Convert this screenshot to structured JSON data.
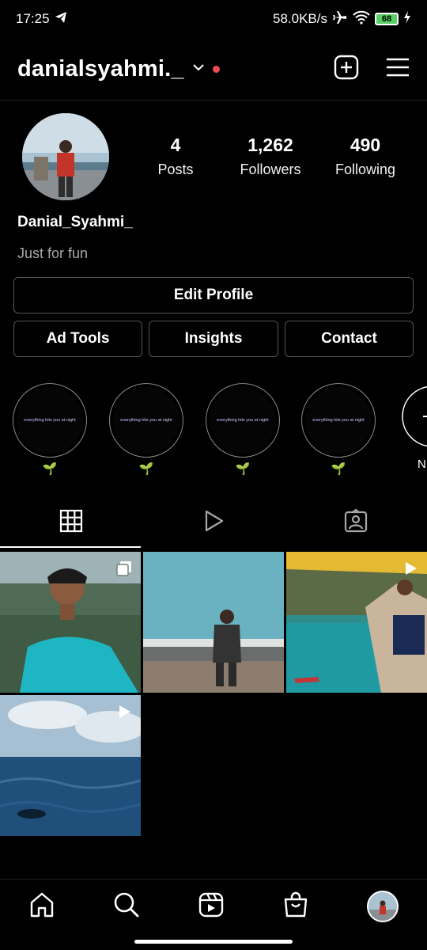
{
  "status_bar": {
    "time": "17:25",
    "network_speed": "58.0KB/s",
    "battery_level": "68"
  },
  "header": {
    "username": "danialsyahmi._"
  },
  "profile": {
    "stats": [
      {
        "value": "4",
        "label": "Posts"
      },
      {
        "value": "1,262",
        "label": "Followers"
      },
      {
        "value": "490",
        "label": "Following"
      }
    ],
    "display_name": "Danial_Syahmi_",
    "bio": "Just for fun"
  },
  "buttons": {
    "edit_profile": "Edit Profile",
    "ad_tools": "Ad Tools",
    "insights": "Insights",
    "contact": "Contact"
  },
  "highlights": {
    "items": [
      {
        "cover_text": "everything hits you at night",
        "label": "🌱"
      },
      {
        "cover_text": "everything hits you at night",
        "label": "🌱"
      },
      {
        "cover_text": "everything hits you at night",
        "label": "🌱"
      },
      {
        "cover_text": "everything hits you at night",
        "label": "🌱"
      }
    ],
    "new_label": "N"
  },
  "tabs": [
    "grid",
    "reels",
    "tagged"
  ],
  "posts": [
    {
      "type": "carousel"
    },
    {
      "type": "photo"
    },
    {
      "type": "reel"
    },
    {
      "type": "reel"
    }
  ],
  "colors": {
    "background": "#000000",
    "notification_dot": "#ed4956",
    "battery": "#57d163"
  }
}
